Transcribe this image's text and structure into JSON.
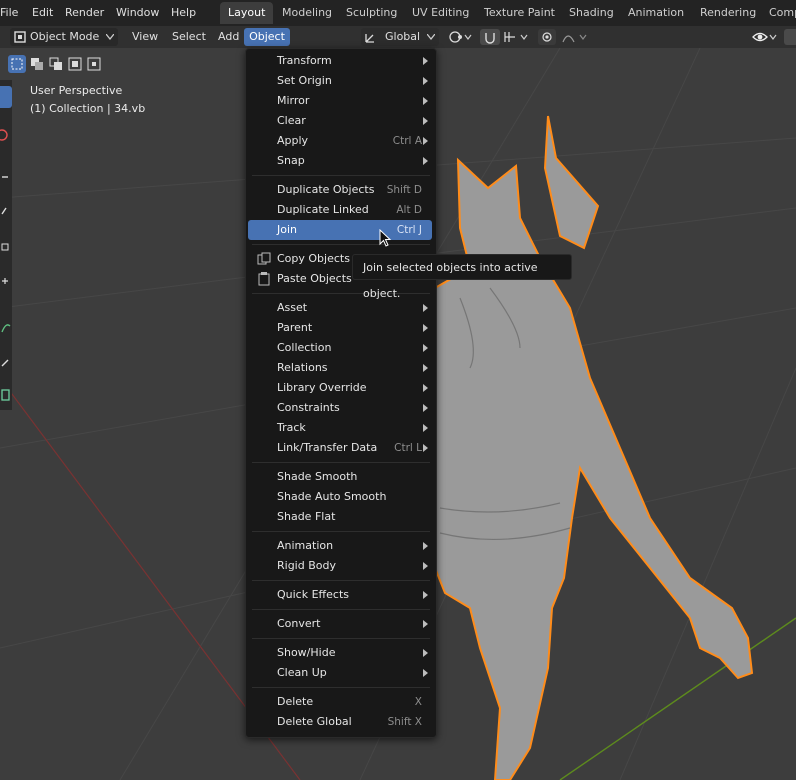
{
  "menubar": {
    "items": [
      "File",
      "Edit",
      "Render",
      "Window",
      "Help"
    ]
  },
  "workspaces": {
    "tabs": [
      "Layout",
      "Modeling",
      "Sculpting",
      "UV Editing",
      "Texture Paint",
      "Shading",
      "Animation",
      "Rendering",
      "Comp"
    ],
    "active": "Layout"
  },
  "header": {
    "mode": "Object Mode",
    "view": "View",
    "select": "Select",
    "add": "Add",
    "object": "Object",
    "transform_orientation": "Global"
  },
  "viewport": {
    "perspective": "User Perspective",
    "collection": "(1) Collection | 34.vb"
  },
  "object_menu": {
    "items": [
      {
        "label": "Transform",
        "shortcut": "",
        "submenu": true
      },
      {
        "label": "Set Origin",
        "shortcut": "",
        "submenu": true
      },
      {
        "label": "Mirror",
        "shortcut": "",
        "submenu": true
      },
      {
        "label": "Clear",
        "shortcut": "",
        "submenu": true
      },
      {
        "label": "Apply",
        "shortcut": "Ctrl A",
        "submenu": true
      },
      {
        "label": "Snap",
        "shortcut": "",
        "submenu": true
      },
      {
        "label": "Duplicate Objects",
        "shortcut": "Shift D",
        "submenu": false
      },
      {
        "label": "Duplicate Linked",
        "shortcut": "Alt D",
        "submenu": false
      },
      {
        "label": "Join",
        "shortcut": "Ctrl J",
        "submenu": false
      },
      {
        "label": "Copy Objects",
        "shortcut": "",
        "submenu": false
      },
      {
        "label": "Paste Objects",
        "shortcut": "",
        "submenu": false
      },
      {
        "label": "Asset",
        "shortcut": "",
        "submenu": true
      },
      {
        "label": "Parent",
        "shortcut": "",
        "submenu": true
      },
      {
        "label": "Collection",
        "shortcut": "",
        "submenu": true
      },
      {
        "label": "Relations",
        "shortcut": "",
        "submenu": true
      },
      {
        "label": "Library Override",
        "shortcut": "",
        "submenu": true
      },
      {
        "label": "Constraints",
        "shortcut": "",
        "submenu": true
      },
      {
        "label": "Track",
        "shortcut": "",
        "submenu": true
      },
      {
        "label": "Link/Transfer Data",
        "shortcut": "Ctrl L",
        "submenu": true
      },
      {
        "label": "Shade Smooth",
        "shortcut": "",
        "submenu": false
      },
      {
        "label": "Shade Auto Smooth",
        "shortcut": "",
        "submenu": false
      },
      {
        "label": "Shade Flat",
        "shortcut": "",
        "submenu": false
      },
      {
        "label": "Animation",
        "shortcut": "",
        "submenu": true
      },
      {
        "label": "Rigid Body",
        "shortcut": "",
        "submenu": true
      },
      {
        "label": "Quick Effects",
        "shortcut": "",
        "submenu": true
      },
      {
        "label": "Convert",
        "shortcut": "",
        "submenu": true
      },
      {
        "label": "Show/Hide",
        "shortcut": "",
        "submenu": true
      },
      {
        "label": "Clean Up",
        "shortcut": "",
        "submenu": true
      },
      {
        "label": "Delete",
        "shortcut": "X",
        "submenu": false
      },
      {
        "label": "Delete Global",
        "shortcut": "Shift X",
        "submenu": false
      }
    ],
    "highlighted": "Join"
  },
  "tooltip": {
    "text": "Join selected objects into active object."
  },
  "colors": {
    "accent": "#4772b3",
    "selection_outline": "#ff8c1a",
    "y_axis": "#6a9a1f",
    "x_axis": "#a33a3a"
  }
}
